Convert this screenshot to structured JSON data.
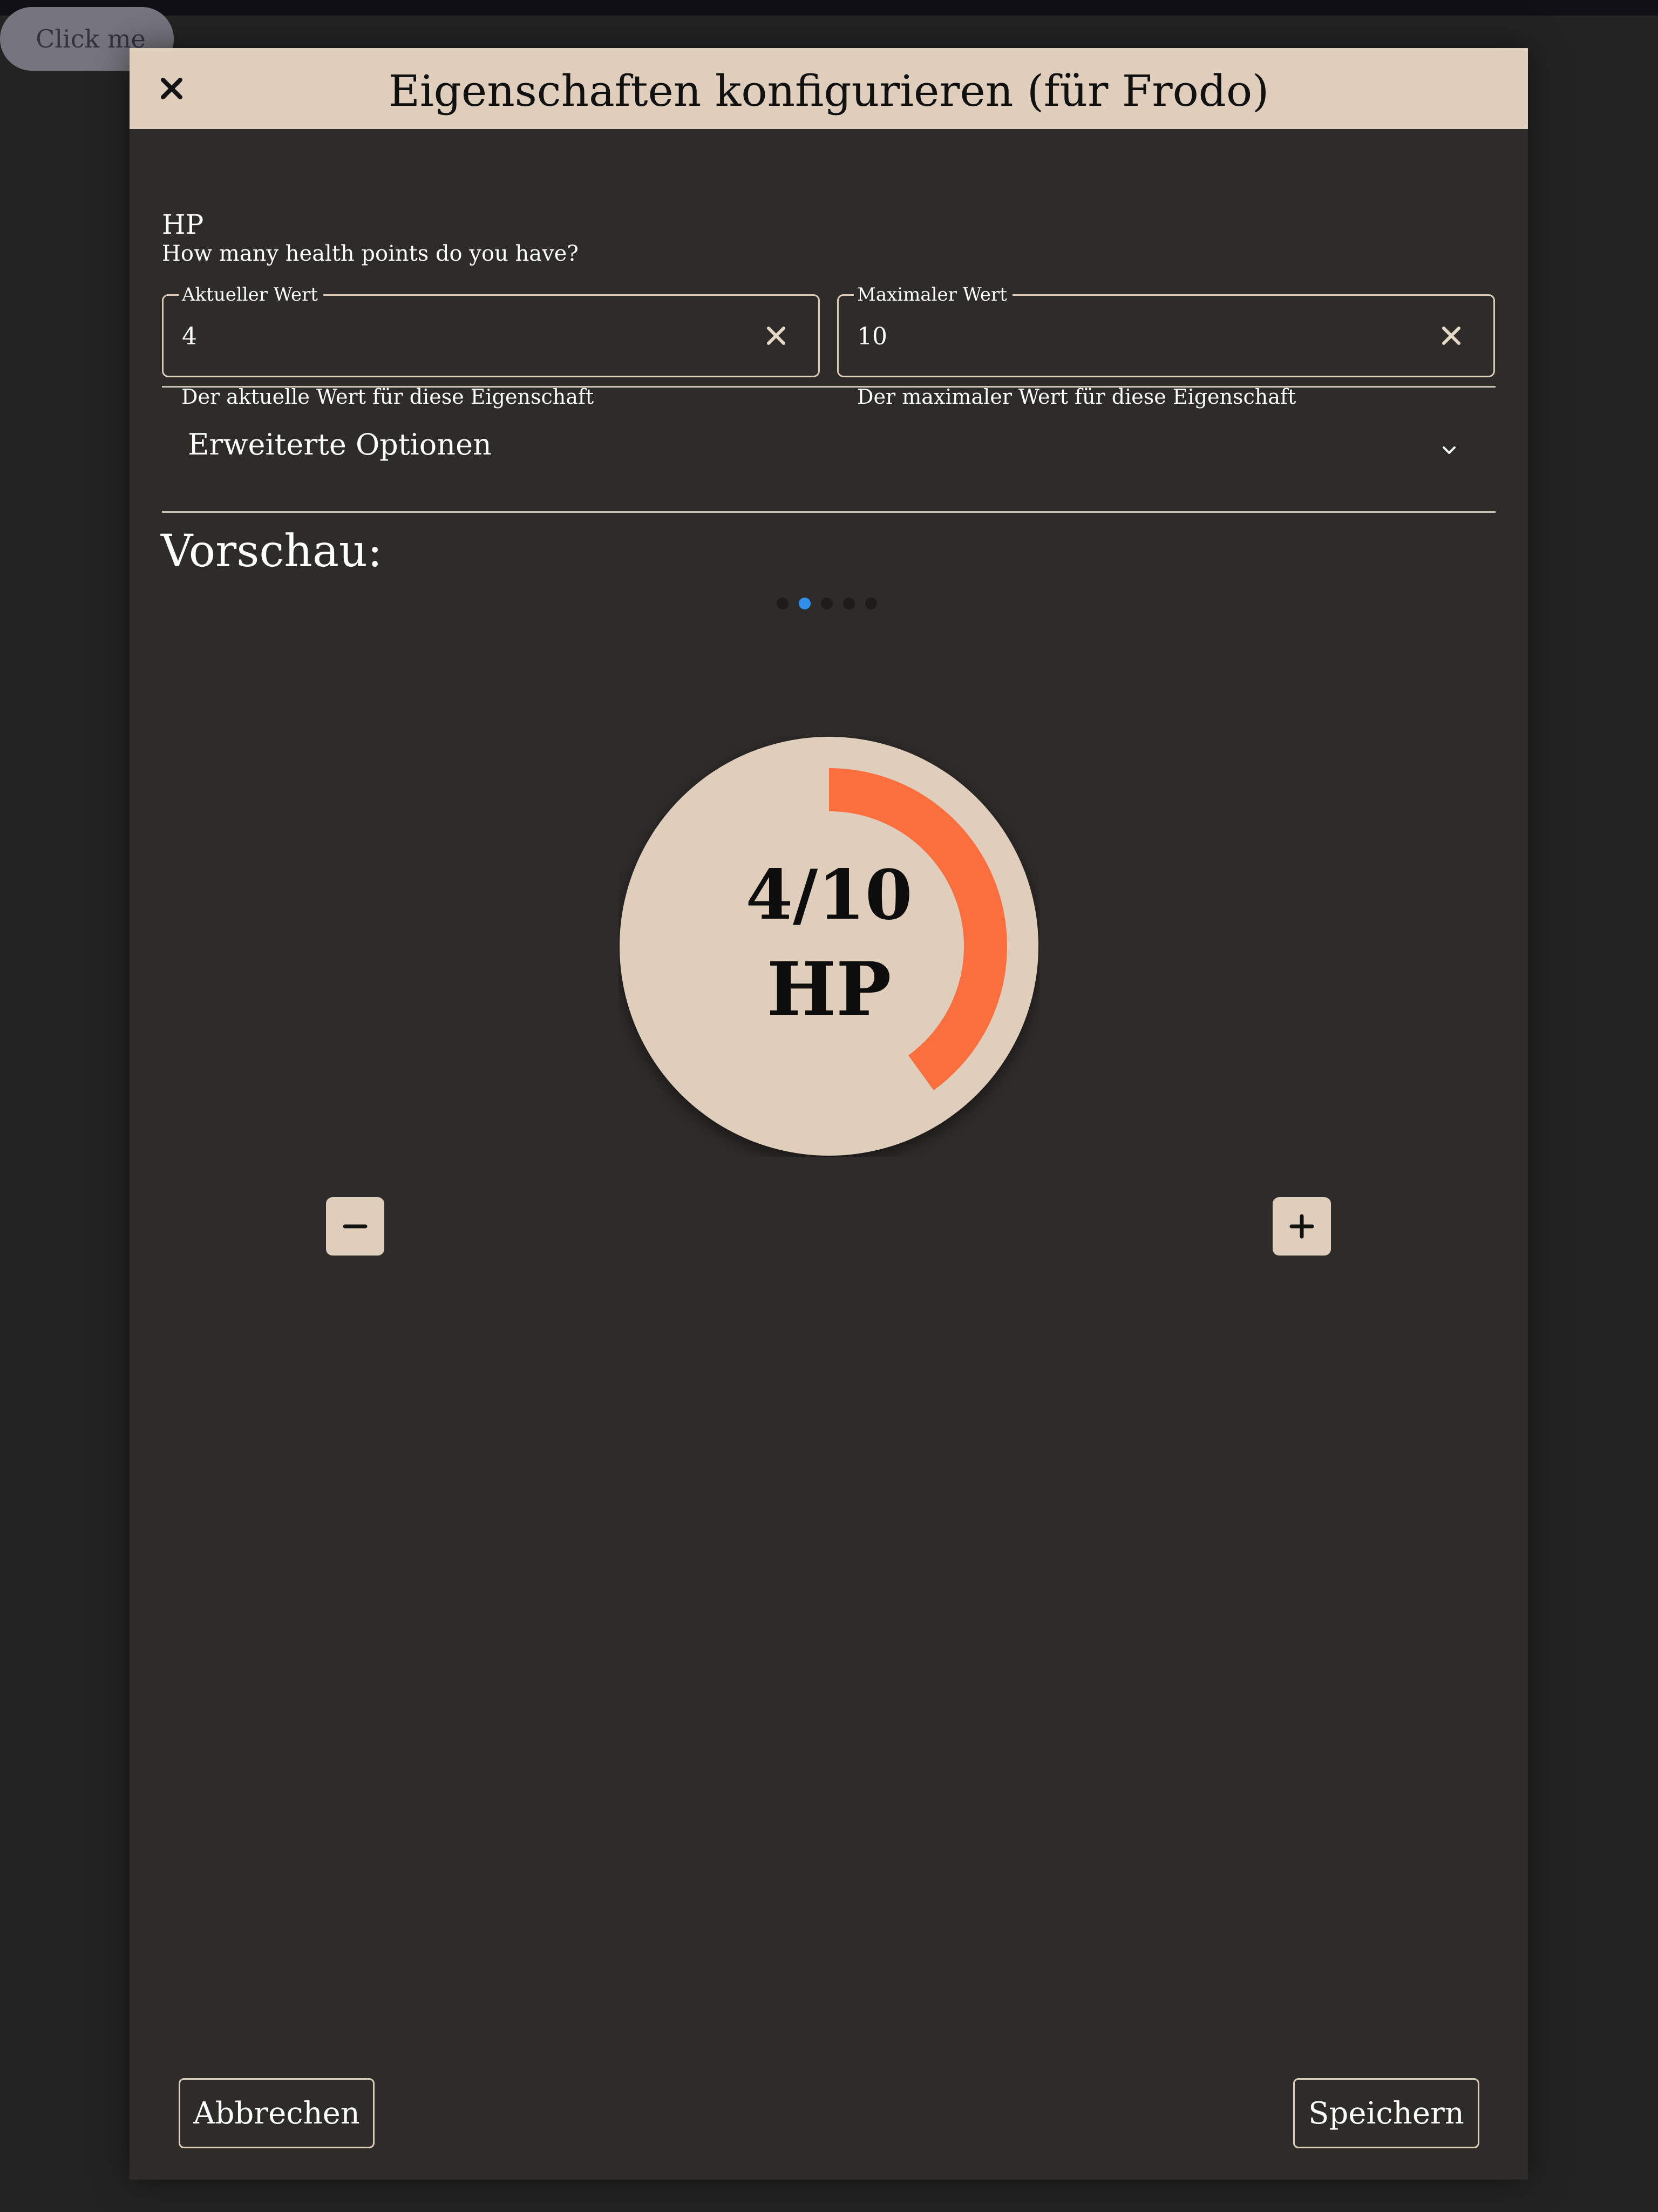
{
  "background_button": {
    "label": "Click me"
  },
  "dialog": {
    "title": "Eigenschaften konfigurieren (für Frodo)",
    "property": {
      "name": "HP",
      "description": "How many health points do you have?"
    },
    "fields": {
      "current": {
        "label": "Aktueller Wert",
        "value": "4",
        "helper": "Der aktuelle Wert für diese Eigenschaft"
      },
      "max": {
        "label": "Maximaler Wert",
        "value": "10",
        "helper": "Der maximaler Wert für diese Eigenschaft"
      }
    },
    "advanced_options": {
      "label": "Erweiterte Optionen",
      "expanded": false
    },
    "preview": {
      "title": "Vorschau:",
      "carousel": {
        "count": 5,
        "active_index": 1
      },
      "gauge": {
        "value_text": "4/10",
        "name": "HP",
        "current": 4,
        "max": 10,
        "fill_color": "#fb6f3f",
        "face_color": "#dfcebb"
      }
    },
    "buttons": {
      "cancel": "Abbrechen",
      "save": "Speichern"
    }
  },
  "colors": {
    "page_background": "#232323",
    "dialog_background": "#2e2c29",
    "header_background": "#dfcebb",
    "accent_dot": "#2f8fea"
  },
  "icons": {
    "close": "close-icon",
    "clear": "clear-icon",
    "chevron": "chevron-down-icon",
    "minus": "minus-icon",
    "plus": "plus-icon"
  }
}
